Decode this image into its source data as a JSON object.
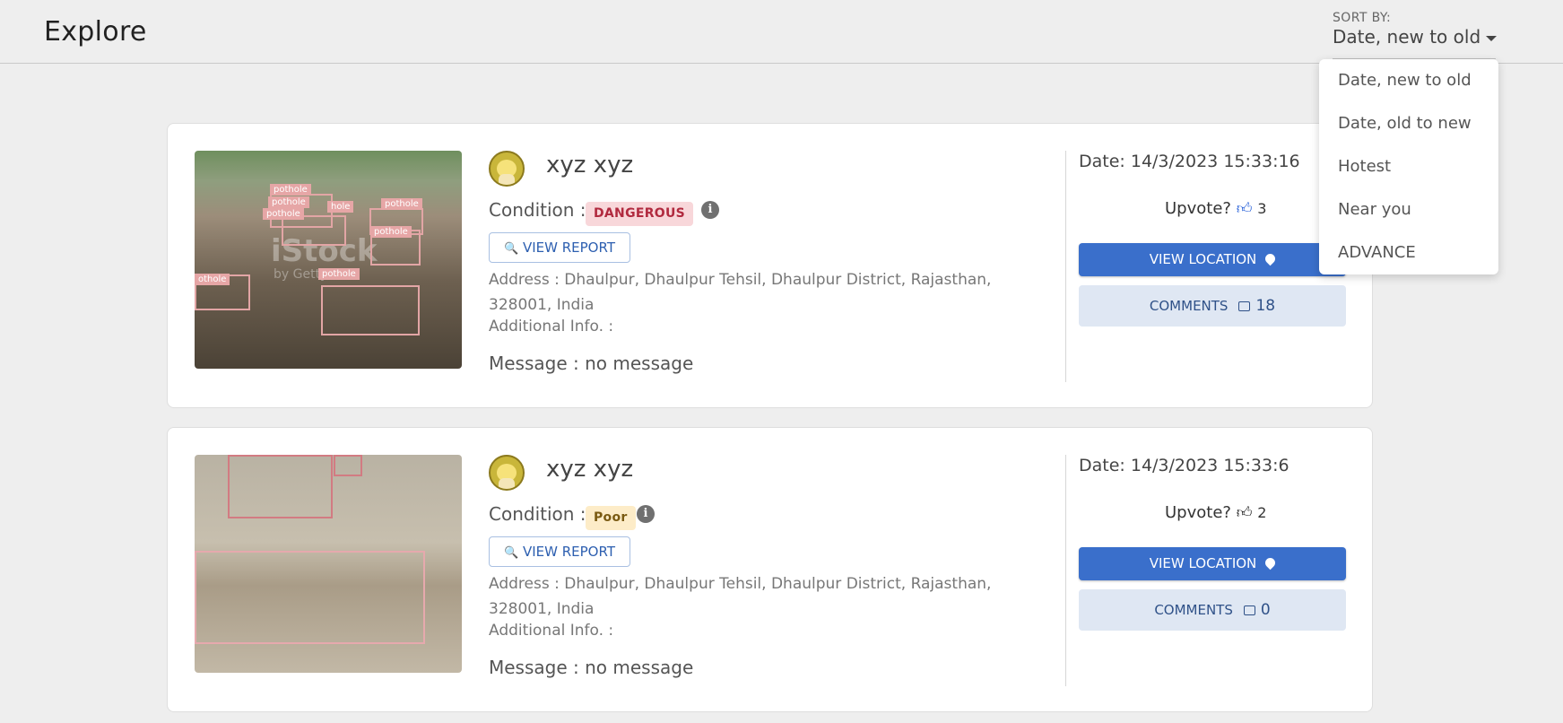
{
  "header": {
    "title": "Explore",
    "sort_label": "SORT BY:",
    "sort_value": "Date, new to old"
  },
  "sort_menu": {
    "items": [
      {
        "label": "Date, new to old"
      },
      {
        "label": "Date, old to new"
      },
      {
        "label": "Hotest"
      },
      {
        "label": "Near you"
      },
      {
        "label": "ADVANCE"
      }
    ]
  },
  "reports": [
    {
      "user": "xyz xyz",
      "condition_label": "Condition :",
      "condition": "DANGEROUS",
      "condition_color": "#b12a3f",
      "view_report": "VIEW REPORT",
      "address": "Address : Dhaulpur, Dhaulpur Tehsil, Dhaulpur District, Rajasthan, 328001, India",
      "additional_info": "Additional Info. :",
      "message": "Message : no message",
      "date": "Date: 14/3/2023 15:33:16",
      "upvote_label": "Upvote?",
      "upvotes": "3",
      "upvote_icon_color": "#1a56d6",
      "view_location": "VIEW LOCATION",
      "comments_label": "COMMENTS",
      "comments": "18",
      "image_labels": [
        "pothole",
        "pothole",
        "pothole",
        "hole",
        "pothole",
        "pothole",
        "pothole",
        "othole"
      ],
      "watermark": "iStock",
      "watermark_sub": "by Getty"
    },
    {
      "user": "xyz xyz",
      "condition_label": "Condition :",
      "condition": "Poor",
      "condition_color": "#7a5a12",
      "view_report": "VIEW REPORT",
      "address": "Address : Dhaulpur, Dhaulpur Tehsil, Dhaulpur District, Rajasthan, 328001, India",
      "additional_info": "Additional Info. :",
      "message": "Message : no message",
      "date": "Date: 14/3/2023 15:33:6",
      "upvote_label": "Upvote?",
      "upvotes": "2",
      "upvote_icon_color": "#111111",
      "view_location": "VIEW LOCATION",
      "comments_label": "COMMENTS",
      "comments": "0"
    }
  ],
  "icons": {
    "search": "search-icon",
    "info": "info-icon",
    "thumbs_up": "thumbs-up-icon",
    "location_pin": "location-pin-icon",
    "comment": "comment-icon",
    "caret": "chevron-down-icon"
  }
}
